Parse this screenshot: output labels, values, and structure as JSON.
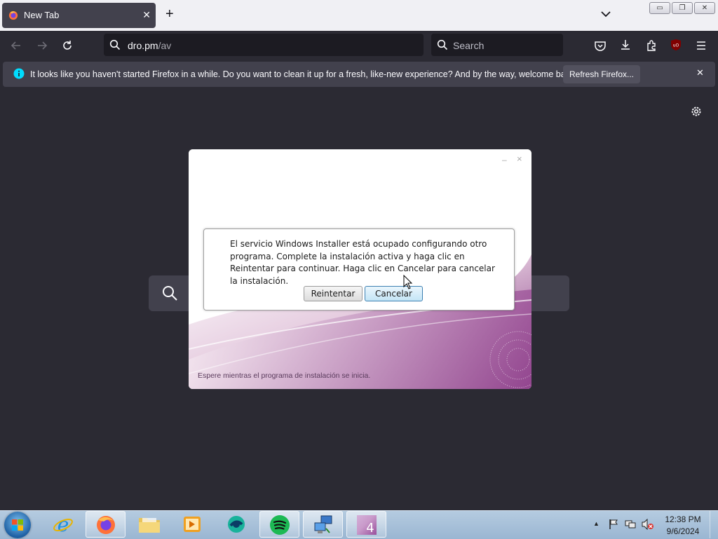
{
  "browser": {
    "tab": {
      "title": "New Tab",
      "close": "✕"
    },
    "new_tab": "+",
    "window_controls": {
      "minimize": "▭",
      "restore": "❐",
      "close": "✕"
    },
    "url": {
      "domain": "dro.pm",
      "path": "/av"
    },
    "search_placeholder": "Search",
    "notification": {
      "text": "It looks like you haven't started Firefox in a while. Do you want to clean it up for a fresh, like-new experience? And by the way, welcome back!",
      "button": "Refresh Firefox...",
      "close": "✕"
    },
    "colors": {
      "accent": "#ff3b30",
      "info": "#00ddff"
    }
  },
  "installer": {
    "minimize": "–",
    "close": "×",
    "status": "Espere mientras el programa de instalación se inicia.",
    "dialog": {
      "message": "El servicio Windows Installer está ocupado configurando otro programa. Complete la instalación activa y haga clic en Reintentar para continuar. Haga clic en Cancelar para cancelar la instalación.",
      "retry": "Reintentar",
      "cancel": "Cancelar"
    }
  },
  "taskbar": {
    "items": [
      "internet-explorer",
      "firefox",
      "file-explorer",
      "media-player",
      "chat-app",
      "spotify",
      "network-app",
      "paint-app"
    ],
    "clock": {
      "time": "12:38 PM",
      "date": "9/6/2024"
    },
    "tray": {
      "show_hidden": "▲"
    }
  }
}
